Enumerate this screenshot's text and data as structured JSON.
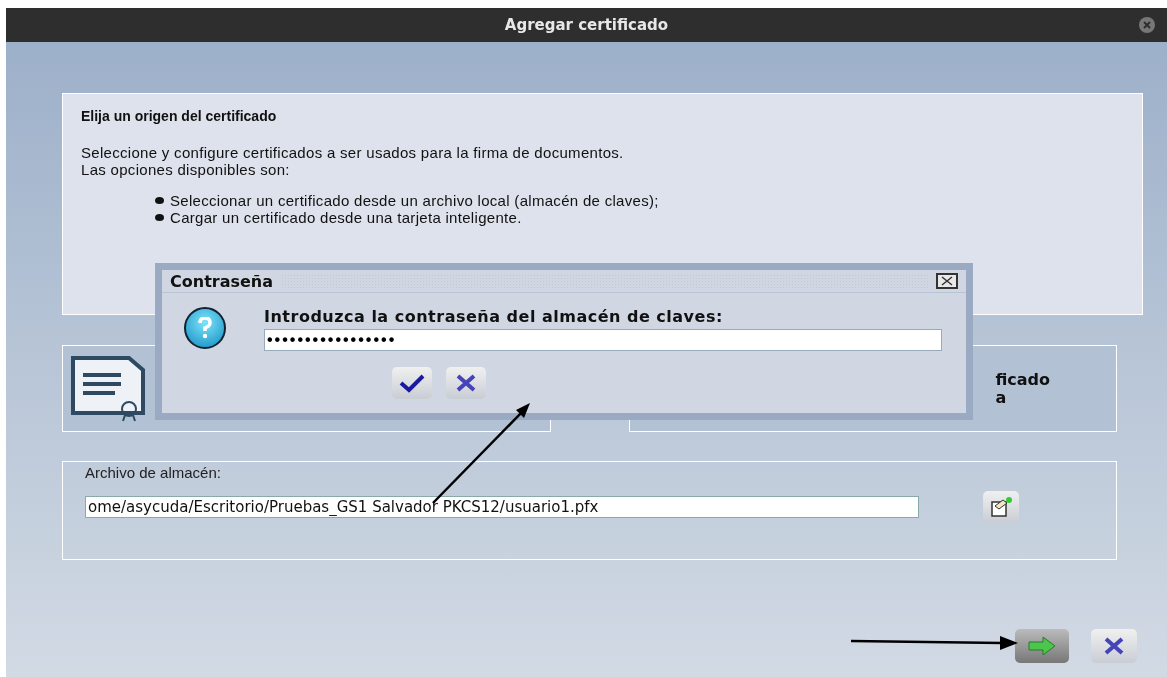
{
  "window": {
    "title": "Agregar certificado"
  },
  "source_panel": {
    "heading": "Elija un origen del certificado",
    "description_lines": [
      "Seleccione y configure certificados a ser usados para la firma de documentos.",
      "Las opciones disponibles son:"
    ],
    "bullets": [
      "Seleccionar un certificado desde un archivo local (almacén de claves);",
      "Cargar un certificado desde una tarjeta inteligente."
    ]
  },
  "option_cards": [
    {
      "kind": "file"
    },
    {
      "kind": "card",
      "visible_lines": [
        "ficado",
        "a"
      ]
    }
  ],
  "keystore_panel": {
    "label": "Archivo de almacén:",
    "value": "ome/asycuda/Escritorio/Pruebas_GS1 Salvador PKCS12/usuario1.pfx"
  },
  "password_dialog": {
    "title": "Contraseña",
    "prompt": "Introduzca la contraseña del almacén de claves:",
    "value": "•••••••••••••••••"
  }
}
